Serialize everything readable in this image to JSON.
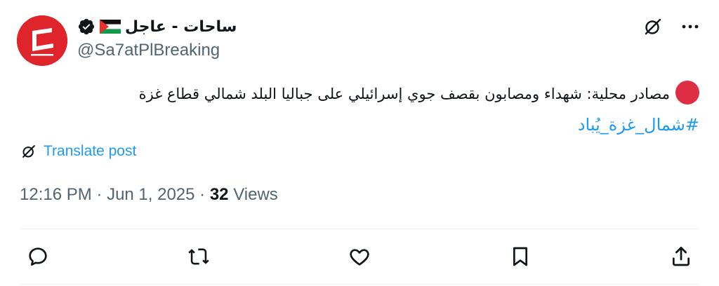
{
  "author": {
    "display_name": "ساحات - عاجل",
    "handle": "@Sa7atPlBreaking",
    "avatar_icon": "sahat-logo",
    "verified_icon": "verified-badge-icon",
    "flag_icon": "palestine-flag-icon"
  },
  "post": {
    "text": "مصادر محلية: شهداء ومصابون بقصف جوي إسرائيلي على جباليا البلد شمالي قطاع غزة",
    "lead_icon": "red-circle-emoji",
    "hashtag": "#شمال_غزة_يُباد"
  },
  "translate_label": "Translate post",
  "meta": {
    "time": "12:16 PM",
    "separator": " · ",
    "date": "Jun 1, 2025",
    "views_count": "32",
    "views_label": " Views"
  },
  "actions": [
    "reply-icon",
    "repost-icon",
    "like-icon",
    "bookmark-icon",
    "share-icon"
  ],
  "colors": {
    "link": "#1d9bf0",
    "secondary_text": "#536471",
    "primary_text": "#0f1419",
    "avatar_red": "#e0242b",
    "red_dot": "#dd2e44"
  }
}
